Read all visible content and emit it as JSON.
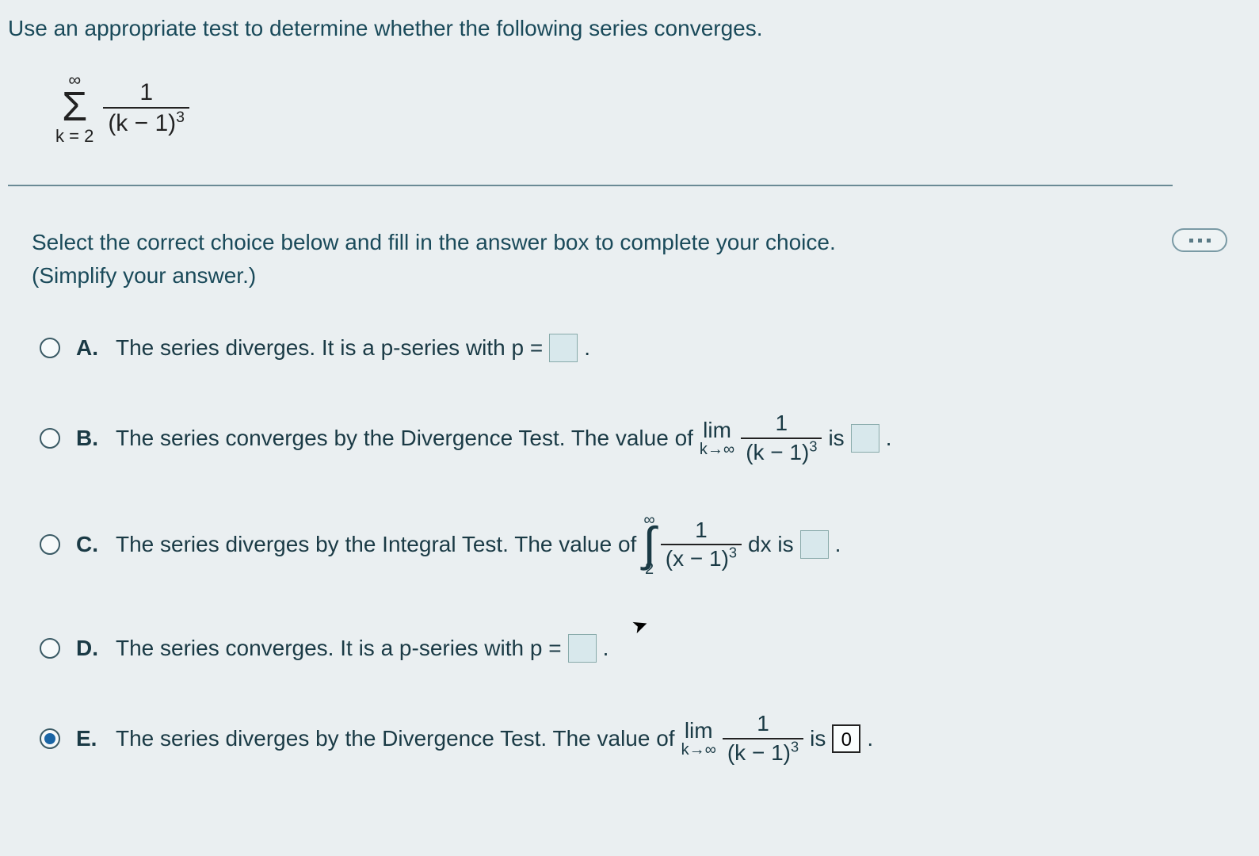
{
  "prompt": "Use an appropriate test to determine whether the following series converges.",
  "series": {
    "upper": "∞",
    "symbol": "Σ",
    "lower": "k = 2",
    "numerator": "1",
    "denominator_base": "(k − 1)",
    "denominator_exp": "3"
  },
  "instruction_line1": "Select the correct choice below and fill in the answer box to complete your choice.",
  "instruction_line2": "(Simplify your answer.)",
  "choices": {
    "A": {
      "letter": "A.",
      "text": "The series diverges. It is a p-series with p =",
      "answer": "",
      "period": "."
    },
    "B": {
      "letter": "B.",
      "text": "The series converges by the Divergence Test. The value of",
      "lim": "lim",
      "lim_sub": "k→∞",
      "frac_num": "1",
      "frac_den_base": "(k − 1)",
      "frac_den_exp": "3",
      "is": "is",
      "answer": "",
      "period": "."
    },
    "C": {
      "letter": "C.",
      "text": "The series diverges by the Integral Test. The value of",
      "int_upper": "∞",
      "int_lower": "2",
      "frac_num": "1",
      "frac_den_base": "(x − 1)",
      "frac_den_exp": "3",
      "dx": "dx is",
      "answer": "",
      "period": "."
    },
    "D": {
      "letter": "D.",
      "text": "The series converges. It is a p-series with p =",
      "answer": "",
      "period": "."
    },
    "E": {
      "letter": "E.",
      "text": "The series diverges by the Divergence Test. The value of",
      "lim": "lim",
      "lim_sub": "k→∞",
      "frac_num": "1",
      "frac_den_base": "(k − 1)",
      "frac_den_exp": "3",
      "is": "is",
      "answer": "0",
      "period": "."
    }
  },
  "selected": "E"
}
